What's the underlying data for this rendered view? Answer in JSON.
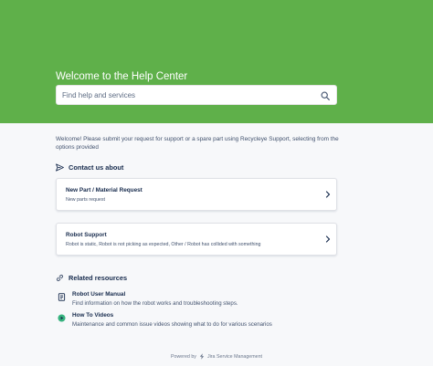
{
  "hero": {
    "title": "Welcome to the Help Center",
    "search_placeholder": "Find help and services",
    "background_color": "#5fb04a"
  },
  "intro": {
    "text": "Welcome! Please submit your request for support or a spare part using Recycleye Support, selecting from the options provided"
  },
  "contact": {
    "heading": "Contact us about",
    "icon": "paper-plane-icon",
    "items": [
      {
        "title": "New Part / Material Request",
        "description": "New parts request"
      },
      {
        "title": "Robot Support",
        "description": "Robot is static, Robot is not picking as expected, Other / Robot has collided with something"
      }
    ]
  },
  "resources": {
    "heading": "Related resources",
    "icon": "link-icon",
    "items": [
      {
        "title": "Robot User Manual",
        "description": "Find information on how the robot works and troubleshooting steps.",
        "icon": "manual-icon"
      },
      {
        "title": "How To Videos",
        "description": "Maintenance and common issue videos showing what to do for various scenarios",
        "icon": "video-icon"
      }
    ]
  },
  "footer": {
    "powered_by": "Powered by",
    "product": "Jira Service Management"
  }
}
